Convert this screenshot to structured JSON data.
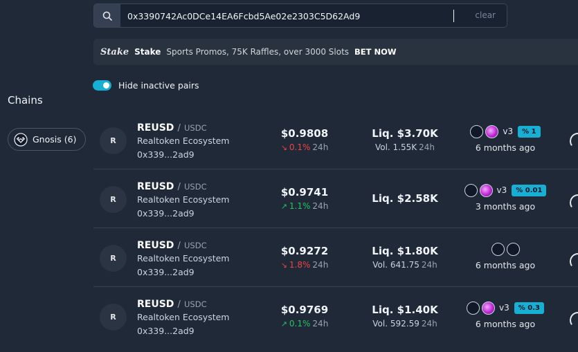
{
  "search": {
    "value": "0x3390742Ac0DCe14EA6Fcbd5Ae02e2303C5D62Ad9",
    "clear_label": "clear"
  },
  "banner": {
    "logo": "Stake",
    "name": "Stake",
    "text": "Sports Promos, 75K Raffles, over 3000 Slots",
    "cta": "BET NOW"
  },
  "filter": {
    "hide_inactive_label": "Hide inactive pairs",
    "hide_inactive_on": true
  },
  "sidebar": {
    "title": "Chains",
    "chains": [
      {
        "label": "Gnosis (6)",
        "icon": "gnosis-icon"
      }
    ]
  },
  "colors": {
    "accent": "#17b0d4",
    "down": "#ef4444",
    "up": "#22c55e",
    "background": "#1f2937"
  },
  "pairs": [
    {
      "avatar": "R",
      "base": "REUSD",
      "sep": "/",
      "quote": "USDC",
      "ecosystem": "Realtoken Ecosystem",
      "address": "0x339...2ad9",
      "price": "$0.9808",
      "change": "0.1%",
      "direction": "down",
      "period": "24h",
      "liquidity": "Liq. $3.70K",
      "volume": "Vol. 1.55K",
      "vol_period": "24h",
      "version": "v3",
      "fee": "% 1",
      "age": "6 months ago"
    },
    {
      "avatar": "R",
      "base": "REUSD",
      "sep": "/",
      "quote": "USDC",
      "ecosystem": "Realtoken Ecosystem",
      "address": "0x339...2ad9",
      "price": "$0.9741",
      "change": "1.1%",
      "direction": "up",
      "period": "24h",
      "liquidity": "Liq. $2.58K",
      "volume": "",
      "vol_period": "",
      "version": "v3",
      "fee": "% 0.01",
      "age": "3 months ago"
    },
    {
      "avatar": "R",
      "base": "REUSD",
      "sep": "/",
      "quote": "USDC",
      "ecosystem": "Realtoken Ecosystem",
      "address": "0x339...2ad9",
      "price": "$0.9272",
      "change": "1.8%",
      "direction": "down",
      "period": "24h",
      "liquidity": "Liq. $1.80K",
      "volume": "Vol. 641.75",
      "vol_period": "24h",
      "version": "",
      "fee": "",
      "age": "6 months ago"
    },
    {
      "avatar": "R",
      "base": "REUSD",
      "sep": "/",
      "quote": "USDC",
      "ecosystem": "Realtoken Ecosystem",
      "address": "0x339...2ad9",
      "price": "$0.9769",
      "change": "0.1%",
      "direction": "up",
      "period": "24h",
      "liquidity": "Liq. $1.40K",
      "volume": "Vol. 592.59",
      "vol_period": "24h",
      "version": "v3",
      "fee": "% 0.3",
      "age": "6 months ago"
    }
  ]
}
